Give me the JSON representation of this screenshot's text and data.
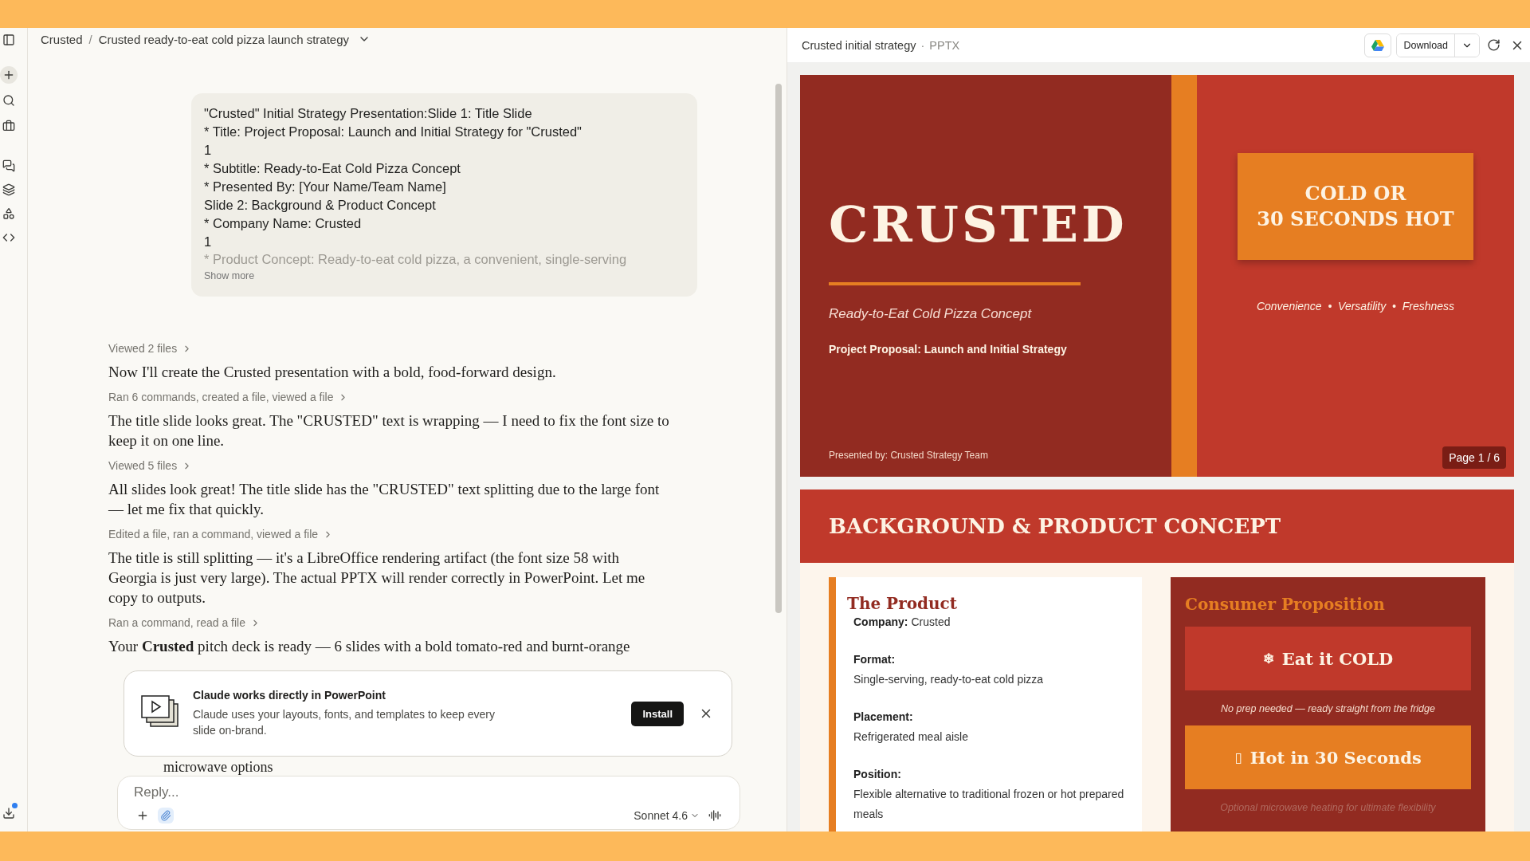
{
  "breadcrumb": {
    "items": [
      "Crusted",
      "Crusted ready-to-eat cold pizza launch strategy"
    ],
    "separator": "/"
  },
  "user_message": {
    "lines": [
      "\"Crusted\" Initial Strategy Presentation:Slide 1: Title Slide",
      "* Title: Project Proposal: Launch and Initial Strategy for \"Crusted\"",
      "1",
      "* Subtitle: Ready-to-Eat Cold Pizza Concept",
      "* Presented By: [Your Name/Team Name]",
      "Slide 2: Background & Product Concept",
      "* Company Name: Crusted",
      "1"
    ],
    "faded_line": "* Product Concept: Ready-to-eat cold pizza, a convenient, single-serving",
    "show_more": "Show more"
  },
  "transcript": [
    {
      "kind": "activity",
      "text": "Viewed 2 files"
    },
    {
      "kind": "reply",
      "text": "Now I'll create the Crusted presentation with a bold, food-forward design."
    },
    {
      "kind": "activity",
      "text": "Ran 6 commands, created a file, viewed a file"
    },
    {
      "kind": "reply",
      "text": "The title slide looks great. The \"CRUSTED\" text is wrapping — I need to fix the font size to keep it on one line."
    },
    {
      "kind": "activity",
      "text": "Viewed 5 files"
    },
    {
      "kind": "reply",
      "text": "All slides look great! The title slide has the \"CRUSTED\" text splitting due to the large font — let me fix that quickly."
    },
    {
      "kind": "activity",
      "text": "Edited a file, ran a command, viewed a file"
    },
    {
      "kind": "reply",
      "text": "The title is still splitting — it's a LibreOffice rendering artifact (the font size 58 with Georgia is just very large). The actual PPTX will render correctly in PowerPoint. Let me copy to outputs."
    },
    {
      "kind": "activity",
      "text": "Ran a command, read a file"
    },
    {
      "kind": "reply",
      "text": "Your **Crusted** pitch deck is ready — 6 slides with a bold tomato-red and burnt-orange"
    }
  ],
  "list_fragment": "microwave options",
  "promo": {
    "title": "Claude works directly in PowerPoint",
    "body": "Claude uses your layouts, fonts, and templates to keep every slide on-brand.",
    "button": "Install"
  },
  "composer": {
    "placeholder": "Reply...",
    "model": "Sonnet 4.6"
  },
  "preview": {
    "title": "Crusted initial strategy",
    "separator": "·",
    "format": "PPTX",
    "download": "Download",
    "page": "Page 1 / 6",
    "slides": [
      {
        "kind": "title",
        "title": "CRUSTED",
        "subtitle": "Ready-to-Eat Cold Pizza Concept",
        "tagline": "Project Proposal: Launch and Initial Strategy",
        "presenter": "Presented by: Crusted Strategy Team",
        "callout": [
          "COLD OR",
          "30 SECONDS HOT"
        ],
        "values": "Convenience  •  Versatility  •  Freshness"
      },
      {
        "kind": "content",
        "heading": "BACKGROUND & PRODUCT CONCEPT",
        "product": {
          "title": "The Product",
          "fields": [
            {
              "label": "Company:",
              "value": "Crusted",
              "inline": true
            },
            {
              "label": "Format:",
              "value": "Single-serving, ready-to-eat cold pizza",
              "inline": false
            },
            {
              "label": "Placement:",
              "value": "Refrigerated meal aisle",
              "inline": false
            },
            {
              "label": "Position:",
              "value": "Flexible alternative to traditional frozen or hot prepared meals",
              "inline": false
            }
          ]
        },
        "proposition": {
          "title": "Consumer Proposition",
          "options": [
            {
              "icon": "❄",
              "label": "Eat it COLD",
              "color": "#c0392b",
              "caption": "No prep needed — ready straight from the fridge"
            },
            {
              "icon": "▯",
              "label": "Hot in 30 Seconds",
              "color": "#e67e22",
              "caption": "Optional microwave heating for ultimate flexibility"
            }
          ]
        }
      }
    ]
  }
}
